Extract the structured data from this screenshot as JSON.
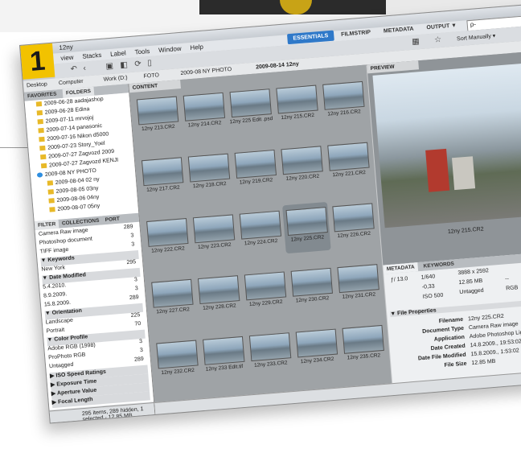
{
  "step_number": "1",
  "window_title": "12ny",
  "menu": [
    "view",
    "Stacks",
    "Label",
    "Tools",
    "Window",
    "Help"
  ],
  "workspaces": [
    {
      "label": "ESSENTIALS",
      "active": true
    },
    {
      "label": "FILMSTRIP",
      "active": false
    },
    {
      "label": "METADATA",
      "active": false
    },
    {
      "label": "OUTPUT ▼",
      "active": false
    }
  ],
  "search_placeholder": "ρ-",
  "sort_label": "Sort Manually ▾",
  "path": [
    "Desktop",
    "Computer",
    "Work (D:)",
    "FOTO",
    "2009-08 NY PHOTO",
    "2009-08-14 12ny"
  ],
  "left_tabs": {
    "favorites": "FAVORITES",
    "folders": "FOLDERS"
  },
  "folders": [
    "2009-06-28 aadajashop",
    "2009-06-28 Edina",
    "2009-07-11 mrvojoj",
    "2009-07-14 panasonic",
    "2009-07-16 Nikon d5000",
    "2009-07-23 Story_Yoel",
    "2009-07-27 Zagvozd 2009",
    "2009-07-27 Zagvozd KENJI",
    "2009-08 NY PHOTO",
    "2009-08-04 02 ny",
    "2009-08-05 03ny",
    "2009-08-06 04ny",
    "2009-08-07 05ny"
  ],
  "filter_tabs": {
    "filter": "FILTER",
    "collections": "COLLECTIONS",
    "export": "PORT"
  },
  "filter_rows": [
    {
      "label": "Camera Raw image",
      "count": "289",
      "header": false
    },
    {
      "label": "Photoshop document",
      "count": "3",
      "header": false
    },
    {
      "label": "TIFF image",
      "count": "3",
      "header": false
    },
    {
      "label": "▼  Keywords",
      "count": "",
      "header": true
    },
    {
      "label": "New York",
      "count": "295",
      "header": false
    },
    {
      "label": "▼  Date Modified",
      "count": "",
      "header": true
    },
    {
      "label": "5.4.2010.",
      "count": "3",
      "header": false
    },
    {
      "label": "8.9.2009.",
      "count": "3",
      "header": false
    },
    {
      "label": "15.8.2009.",
      "count": "289",
      "header": false
    },
    {
      "label": "▼  Orientation",
      "count": "",
      "header": true
    },
    {
      "label": "Landscape",
      "count": "225",
      "header": false
    },
    {
      "label": "Portrait",
      "count": "70",
      "header": false
    },
    {
      "label": "▼  Color Profile",
      "count": "",
      "header": true
    },
    {
      "label": "Adobe RGB (1998)",
      "count": "3",
      "header": false
    },
    {
      "label": "ProPhoto RGB",
      "count": "3",
      "header": false
    },
    {
      "label": "Untagged",
      "count": "289",
      "header": false
    },
    {
      "label": "▶  ISO Speed Ratings",
      "count": "",
      "header": true
    },
    {
      "label": "▶  Exposure Time",
      "count": "",
      "header": true
    },
    {
      "label": "▶  Aperture Value",
      "count": "",
      "header": true
    },
    {
      "label": "▶  Focal Length",
      "count": "",
      "header": true
    }
  ],
  "status_text": "295 items, 289 hidden, 1 selected - 12.85 MB",
  "content_header": "CONTENT",
  "thumbnails": [
    "12ny 213.CR2",
    "12ny 214.CR2",
    "12ny 225 Edit .psd",
    "12ny 215.CR2",
    "12ny 216.CR2",
    "12ny 217.CR2",
    "12ny 218.CR2",
    "12ny 219.CR2",
    "12ny 220.CR2",
    "12ny 221.CR2",
    "12ny 222.CR2",
    "12ny 223.CR2",
    "12ny 224.CR2",
    "12ny 225.CR2",
    "12ny 226.CR2",
    "12ny 227.CR2",
    "12ny 228.CR2",
    "12ny 229.CR2",
    "12ny 230.CR2",
    "12ny 231.CR2",
    "12ny 232.CR2",
    "12ny 233 Edit.tif",
    "12ny 233.CR2",
    "12ny 234.CR2",
    "12ny 235.CR2"
  ],
  "selected_index": 13,
  "preview_header": "PREVIEW",
  "preview_label": "12ny 215.CR2",
  "meta_tabs": {
    "metadata": "METADATA",
    "keywords": "KEYWORDS"
  },
  "camera": {
    "aperture": "ƒ/ 13.0",
    "shutter": "1/640",
    "ev": "-0,33",
    "iso": "ISO 500",
    "dims": "3888 x 2592",
    "size": "12.85 MB",
    "dash": "--",
    "profile": "Untagged",
    "mode": "RGB"
  },
  "file_properties_label": "▼  File Properties",
  "file_properties": [
    {
      "key": "Filename",
      "value": "12ny 225.CR2"
    },
    {
      "key": "Document Type",
      "value": "Camera Raw image"
    },
    {
      "key": "Application",
      "value": "Adobe Photoshop Lightroom"
    },
    {
      "key": "Date Created",
      "value": "14.8.2009., 19:53:02"
    },
    {
      "key": "Date File Modified",
      "value": "15.8.2009., 1:53:02"
    },
    {
      "key": "File Size",
      "value": "12.85 MB"
    }
  ]
}
